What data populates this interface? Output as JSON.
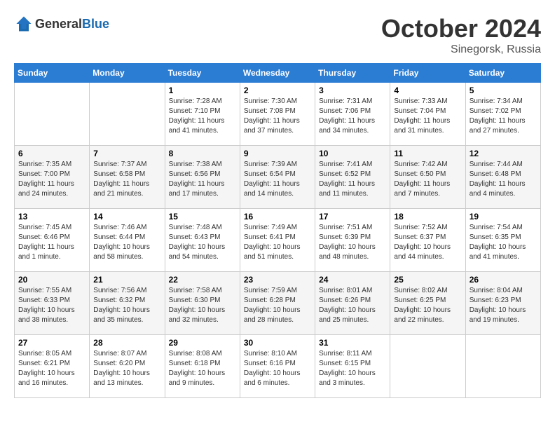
{
  "header": {
    "logo_general": "General",
    "logo_blue": "Blue",
    "month": "October 2024",
    "location": "Sinegorsk, Russia"
  },
  "weekdays": [
    "Sunday",
    "Monday",
    "Tuesday",
    "Wednesday",
    "Thursday",
    "Friday",
    "Saturday"
  ],
  "weeks": [
    [
      {
        "day": "",
        "info": ""
      },
      {
        "day": "",
        "info": ""
      },
      {
        "day": "1",
        "info": "Sunrise: 7:28 AM\nSunset: 7:10 PM\nDaylight: 11 hours and 41 minutes."
      },
      {
        "day": "2",
        "info": "Sunrise: 7:30 AM\nSunset: 7:08 PM\nDaylight: 11 hours and 37 minutes."
      },
      {
        "day": "3",
        "info": "Sunrise: 7:31 AM\nSunset: 7:06 PM\nDaylight: 11 hours and 34 minutes."
      },
      {
        "day": "4",
        "info": "Sunrise: 7:33 AM\nSunset: 7:04 PM\nDaylight: 11 hours and 31 minutes."
      },
      {
        "day": "5",
        "info": "Sunrise: 7:34 AM\nSunset: 7:02 PM\nDaylight: 11 hours and 27 minutes."
      }
    ],
    [
      {
        "day": "6",
        "info": "Sunrise: 7:35 AM\nSunset: 7:00 PM\nDaylight: 11 hours and 24 minutes."
      },
      {
        "day": "7",
        "info": "Sunrise: 7:37 AM\nSunset: 6:58 PM\nDaylight: 11 hours and 21 minutes."
      },
      {
        "day": "8",
        "info": "Sunrise: 7:38 AM\nSunset: 6:56 PM\nDaylight: 11 hours and 17 minutes."
      },
      {
        "day": "9",
        "info": "Sunrise: 7:39 AM\nSunset: 6:54 PM\nDaylight: 11 hours and 14 minutes."
      },
      {
        "day": "10",
        "info": "Sunrise: 7:41 AM\nSunset: 6:52 PM\nDaylight: 11 hours and 11 minutes."
      },
      {
        "day": "11",
        "info": "Sunrise: 7:42 AM\nSunset: 6:50 PM\nDaylight: 11 hours and 7 minutes."
      },
      {
        "day": "12",
        "info": "Sunrise: 7:44 AM\nSunset: 6:48 PM\nDaylight: 11 hours and 4 minutes."
      }
    ],
    [
      {
        "day": "13",
        "info": "Sunrise: 7:45 AM\nSunset: 6:46 PM\nDaylight: 11 hours and 1 minute."
      },
      {
        "day": "14",
        "info": "Sunrise: 7:46 AM\nSunset: 6:44 PM\nDaylight: 10 hours and 58 minutes."
      },
      {
        "day": "15",
        "info": "Sunrise: 7:48 AM\nSunset: 6:43 PM\nDaylight: 10 hours and 54 minutes."
      },
      {
        "day": "16",
        "info": "Sunrise: 7:49 AM\nSunset: 6:41 PM\nDaylight: 10 hours and 51 minutes."
      },
      {
        "day": "17",
        "info": "Sunrise: 7:51 AM\nSunset: 6:39 PM\nDaylight: 10 hours and 48 minutes."
      },
      {
        "day": "18",
        "info": "Sunrise: 7:52 AM\nSunset: 6:37 PM\nDaylight: 10 hours and 44 minutes."
      },
      {
        "day": "19",
        "info": "Sunrise: 7:54 AM\nSunset: 6:35 PM\nDaylight: 10 hours and 41 minutes."
      }
    ],
    [
      {
        "day": "20",
        "info": "Sunrise: 7:55 AM\nSunset: 6:33 PM\nDaylight: 10 hours and 38 minutes."
      },
      {
        "day": "21",
        "info": "Sunrise: 7:56 AM\nSunset: 6:32 PM\nDaylight: 10 hours and 35 minutes."
      },
      {
        "day": "22",
        "info": "Sunrise: 7:58 AM\nSunset: 6:30 PM\nDaylight: 10 hours and 32 minutes."
      },
      {
        "day": "23",
        "info": "Sunrise: 7:59 AM\nSunset: 6:28 PM\nDaylight: 10 hours and 28 minutes."
      },
      {
        "day": "24",
        "info": "Sunrise: 8:01 AM\nSunset: 6:26 PM\nDaylight: 10 hours and 25 minutes."
      },
      {
        "day": "25",
        "info": "Sunrise: 8:02 AM\nSunset: 6:25 PM\nDaylight: 10 hours and 22 minutes."
      },
      {
        "day": "26",
        "info": "Sunrise: 8:04 AM\nSunset: 6:23 PM\nDaylight: 10 hours and 19 minutes."
      }
    ],
    [
      {
        "day": "27",
        "info": "Sunrise: 8:05 AM\nSunset: 6:21 PM\nDaylight: 10 hours and 16 minutes."
      },
      {
        "day": "28",
        "info": "Sunrise: 8:07 AM\nSunset: 6:20 PM\nDaylight: 10 hours and 13 minutes."
      },
      {
        "day": "29",
        "info": "Sunrise: 8:08 AM\nSunset: 6:18 PM\nDaylight: 10 hours and 9 minutes."
      },
      {
        "day": "30",
        "info": "Sunrise: 8:10 AM\nSunset: 6:16 PM\nDaylight: 10 hours and 6 minutes."
      },
      {
        "day": "31",
        "info": "Sunrise: 8:11 AM\nSunset: 6:15 PM\nDaylight: 10 hours and 3 minutes."
      },
      {
        "day": "",
        "info": ""
      },
      {
        "day": "",
        "info": ""
      }
    ]
  ]
}
